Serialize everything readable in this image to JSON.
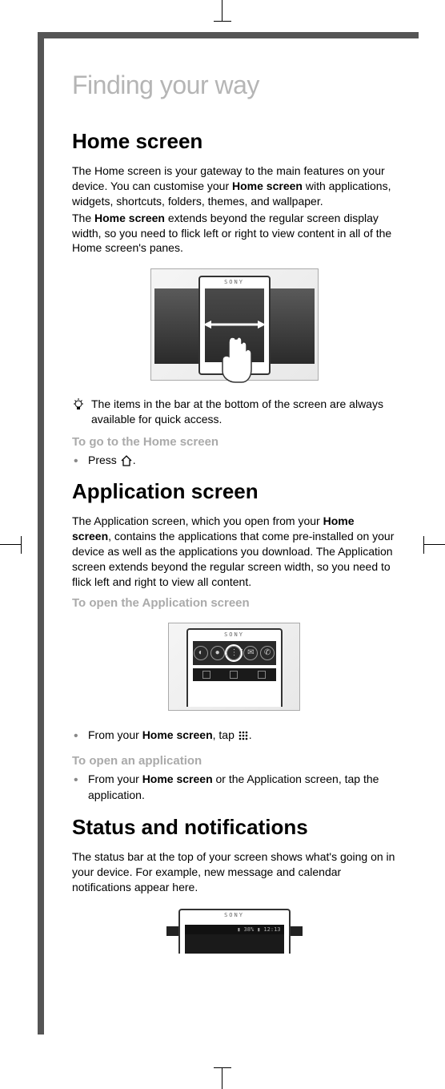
{
  "chapter_title": "Finding your way",
  "home": {
    "heading": "Home screen",
    "para1_a": "The Home screen is your gateway to the main features on your device. You can customise your ",
    "para1_bold": "Home screen",
    "para1_b": " with applications, widgets, shortcuts, folders, themes, and wallpaper.",
    "para2_a": "The ",
    "para2_bold": "Home screen",
    "para2_b": " extends beyond the regular screen display width, so you need to flick left or right to view content in all of the Home screen's panes.",
    "tip": "The items in the bar at the bottom of the screen are always available for quick access.",
    "task1_title": "To go to the Home screen",
    "task1_step_a": "Press ",
    "task1_step_b": "."
  },
  "app": {
    "heading": "Application screen",
    "para_a": "The Application screen, which you open from your ",
    "para_bold": "Home screen",
    "para_b": ", contains the applications that come pre-installed on your device as well as the applications you download. The Application screen extends beyond the regular screen width, so you need to flick left and right to view all content.",
    "task1_title": "To open the Application screen",
    "task1_step_a": "From your ",
    "task1_step_bold": "Home screen",
    "task1_step_b": ", tap ",
    "task1_step_c": ".",
    "task2_title": "To open an application",
    "task2_step_a": "From your ",
    "task2_step_bold": "Home screen",
    "task2_step_b": " or the Application screen, tap the application."
  },
  "status": {
    "heading": "Status and notifications",
    "para": "The status bar at the top of your screen shows what's going on in your device. For example, new message and calendar notifications appear here.",
    "battery": "38%",
    "time": "12:13"
  },
  "brand": "SONY"
}
